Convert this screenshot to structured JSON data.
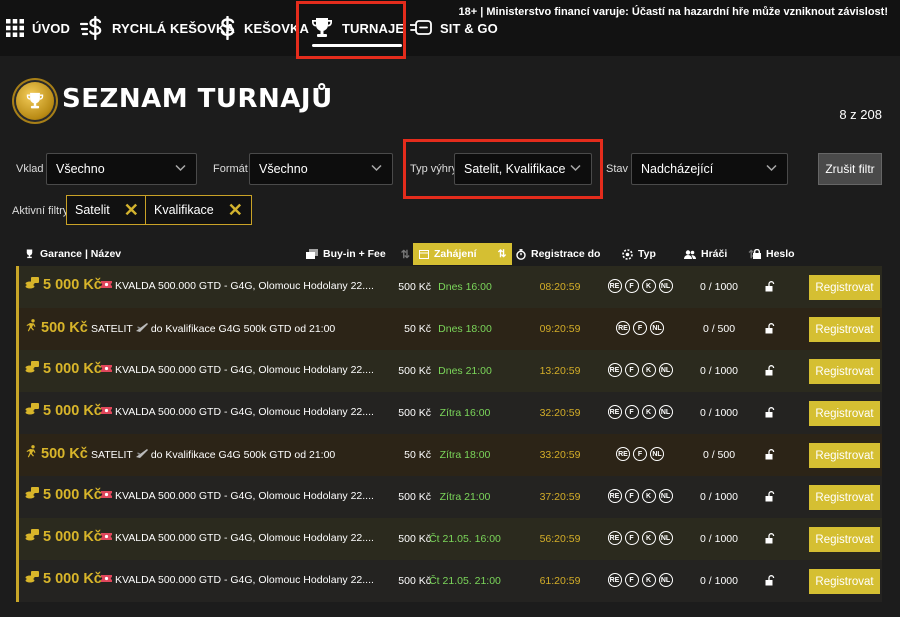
{
  "nav": {
    "items": [
      {
        "label": "ÚVOD",
        "icon": "grid-icon"
      },
      {
        "label": "RYCHLÁ KEŠOVKA",
        "icon": "fast-dollar-icon"
      },
      {
        "label": "KEŠOVKA",
        "icon": "dollar-icon"
      },
      {
        "label": "TURNAJE",
        "icon": "trophy-icon"
      },
      {
        "label": "SIT & GO",
        "icon": "sitgo-icon"
      }
    ],
    "active": "TURNAJE",
    "warning": "18+ | Ministerstvo financí varuje: Účastí na hazardní hře může vzniknout závislost!"
  },
  "header": {
    "title": "SEZNAM TURNAJŮ",
    "count": "8 z 208"
  },
  "filters": {
    "vklad": {
      "label": "Vklad",
      "value": "Všechno"
    },
    "format": {
      "label": "Formát",
      "value": "Všechno"
    },
    "typ": {
      "label": "Typ výhry",
      "value": "Satelit, Kvalifikace"
    },
    "stav": {
      "label": "Stav",
      "value": "Nadcházející"
    },
    "clear": "Zrušit filtr",
    "active_label": "Aktivní filtry",
    "chips": [
      "Satelit",
      "Kvalifikace"
    ]
  },
  "columns": {
    "name": "Garance | Název",
    "buyin": "Buy-in + Fee",
    "start": "Zahájení",
    "reg": "Registrace do",
    "type": "Typ",
    "players": "Hráči",
    "password": "Heslo"
  },
  "rows": [
    {
      "kind": "kval",
      "guarantee": "5 000 Kč",
      "name": "KVALDA 500.000 GTD - G4G, Olomouc Hodolany 22....",
      "buyin": "500 Kč",
      "start": "Dnes 16:00",
      "reg": "08:20:59",
      "types": [
        "RE",
        "F",
        "K",
        "NL"
      ],
      "players": "0 / 1000",
      "button": "Registrovat"
    },
    {
      "kind": "sat",
      "guarantee": "500 Kč",
      "name_a": "SATELIT",
      "name_b": "do Kvalifikace G4G 500k GTD od 21:00",
      "buyin": "50 Kč",
      "start": "Dnes 18:00",
      "reg": "09:20:59",
      "types": [
        "RE",
        "F",
        "NL"
      ],
      "players": "0 / 500",
      "button": "Registrovat"
    },
    {
      "kind": "kval",
      "guarantee": "5 000 Kč",
      "name": "KVALDA 500.000 GTD - G4G, Olomouc Hodolany 22....",
      "buyin": "500 Kč",
      "start": "Dnes 21:00",
      "reg": "13:20:59",
      "types": [
        "RE",
        "F",
        "K",
        "NL"
      ],
      "players": "0 / 1000",
      "button": "Registrovat"
    },
    {
      "kind": "kval",
      "guarantee": "5 000 Kč",
      "name": "KVALDA 500.000 GTD - G4G, Olomouc Hodolany 22....",
      "buyin": "500 Kč",
      "start": "Zítra 16:00",
      "reg": "32:20:59",
      "types": [
        "RE",
        "F",
        "K",
        "NL"
      ],
      "players": "0 / 1000",
      "button": "Registrovat"
    },
    {
      "kind": "sat",
      "guarantee": "500 Kč",
      "name_a": "SATELIT",
      "name_b": "do Kvalifikace G4G 500k GTD od 21:00",
      "buyin": "50 Kč",
      "start": "Zítra 18:00",
      "reg": "33:20:59",
      "types": [
        "RE",
        "F",
        "NL"
      ],
      "players": "0 / 500",
      "button": "Registrovat"
    },
    {
      "kind": "kval",
      "guarantee": "5 000 Kč",
      "name": "KVALDA 500.000 GTD - G4G, Olomouc Hodolany 22....",
      "buyin": "500 Kč",
      "start": "Zítra 21:00",
      "reg": "37:20:59",
      "types": [
        "RE",
        "F",
        "K",
        "NL"
      ],
      "players": "0 / 1000",
      "button": "Registrovat"
    },
    {
      "kind": "kval",
      "guarantee": "5 000 Kč",
      "name": "KVALDA 500.000 GTD - G4G, Olomouc Hodolany 22....",
      "buyin": "500 Kč",
      "start": "Čt 21.05. 16:00",
      "reg": "56:20:59",
      "types": [
        "RE",
        "F",
        "K",
        "NL"
      ],
      "players": "0 / 1000",
      "button": "Registrovat"
    },
    {
      "kind": "kval",
      "guarantee": "5 000 Kč",
      "name": "KVALDA 500.000 GTD - G4G, Olomouc Hodolany 22....",
      "buyin": "500 Kč",
      "start": "Čt 21.05. 21:00",
      "reg": "61:20:59",
      "types": [
        "RE",
        "F",
        "K",
        "NL"
      ],
      "players": "0 / 1000",
      "button": "Registrovat"
    }
  ],
  "colors": {
    "accent": "#d5bf32",
    "highlight": "#e42c1c",
    "start_green": "#7bd65a",
    "reg_gold": "#d3ad28"
  }
}
